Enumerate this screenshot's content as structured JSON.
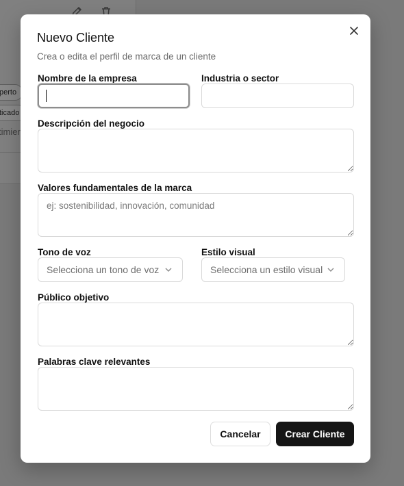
{
  "background": {
    "badges": [
      "perto",
      "ticado"
    ],
    "text": "timier"
  },
  "dialog": {
    "title": "Nuevo Cliente",
    "subtitle": "Crea o edita el perfil de marca de un cliente",
    "fields": {
      "company_name": {
        "label": "Nombre de la empresa",
        "value": ""
      },
      "industry": {
        "label": "Industria o sector",
        "value": ""
      },
      "description": {
        "label": "Descripción del negocio",
        "value": ""
      },
      "brand_values": {
        "label": "Valores fundamentales de la marca",
        "placeholder": "ej: sostenibilidad, innovación, comunidad",
        "value": ""
      },
      "tone": {
        "label": "Tono de voz",
        "placeholder": "Selecciona un tono de voz"
      },
      "visual_style": {
        "label": "Estilo visual",
        "placeholder": "Selecciona un estilo visual"
      },
      "audience": {
        "label": "Público objetivo",
        "value": ""
      },
      "keywords": {
        "label": "Palabras clave relevantes",
        "value": ""
      }
    },
    "buttons": {
      "cancel": "Cancelar",
      "create": "Crear Cliente"
    }
  },
  "colors": {
    "primary_button": "#151515",
    "overlay": "#7a7a7a"
  }
}
